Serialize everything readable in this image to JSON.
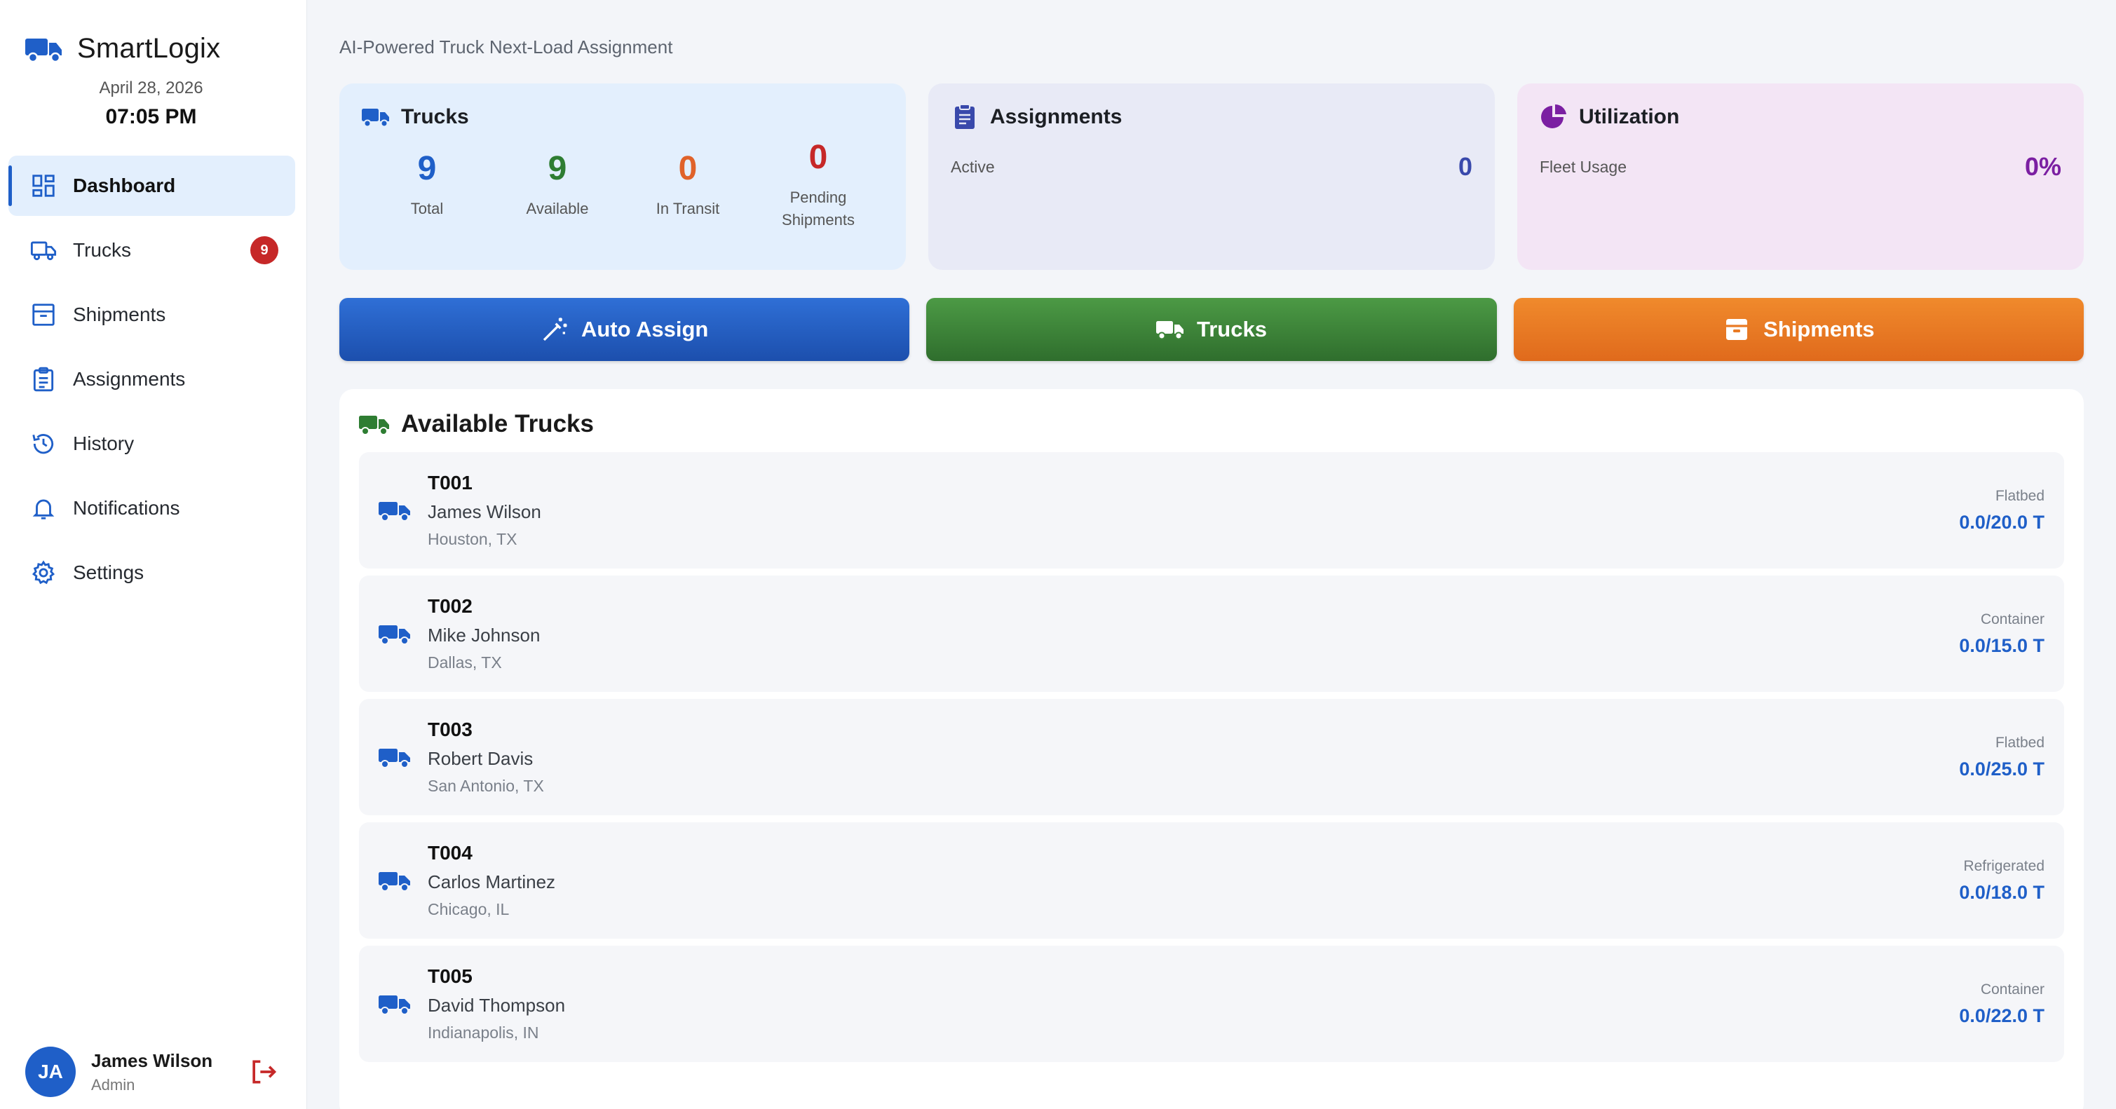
{
  "app": {
    "name": "SmartLogix",
    "date": "April 28, 2026",
    "time": "07:05 PM"
  },
  "sidebar": {
    "items": [
      {
        "label": "Dashboard",
        "icon": "dashboard-icon",
        "active": true
      },
      {
        "label": "Trucks",
        "icon": "truck-icon",
        "badge": "9"
      },
      {
        "label": "Shipments",
        "icon": "archive-icon"
      },
      {
        "label": "Assignments",
        "icon": "clipboard-icon"
      },
      {
        "label": "History",
        "icon": "history-icon"
      },
      {
        "label": "Notifications",
        "icon": "bell-icon"
      },
      {
        "label": "Settings",
        "icon": "gear-icon"
      }
    ]
  },
  "user": {
    "initials": "JA",
    "name": "James Wilson",
    "role": "Admin"
  },
  "header": {
    "subtitle": "AI-Powered Truck Next-Load Assignment"
  },
  "stats": {
    "trucks": {
      "title": "Trucks",
      "items": [
        {
          "value": "9",
          "label": "Total",
          "color": "#1f5fc8"
        },
        {
          "value": "9",
          "label": "Available",
          "color": "#2e7d32"
        },
        {
          "value": "0",
          "label": "In Transit",
          "color": "#e0622a"
        },
        {
          "value": "0",
          "label": "Pending Shipments",
          "color": "#c62828"
        }
      ]
    },
    "assignments": {
      "title": "Assignments",
      "key": "Active",
      "value": "0",
      "color": "#3949ab"
    },
    "utilization": {
      "title": "Utilization",
      "key": "Fleet Usage",
      "value": "0%",
      "color": "#7b1fa2"
    }
  },
  "actions": {
    "auto_assign": "Auto Assign",
    "trucks": "Trucks",
    "shipments": "Shipments"
  },
  "available": {
    "title": "Available Trucks",
    "trucks": [
      {
        "id": "T001",
        "driver": "James Wilson",
        "location": "Houston, TX",
        "type": "Flatbed",
        "capacity": "0.0/20.0 T"
      },
      {
        "id": "T002",
        "driver": "Mike Johnson",
        "location": "Dallas, TX",
        "type": "Container",
        "capacity": "0.0/15.0 T"
      },
      {
        "id": "T003",
        "driver": "Robert Davis",
        "location": "San Antonio, TX",
        "type": "Flatbed",
        "capacity": "0.0/25.0 T"
      },
      {
        "id": "T004",
        "driver": "Carlos Martinez",
        "location": "Chicago, IL",
        "type": "Refrigerated",
        "capacity": "0.0/18.0 T"
      },
      {
        "id": "T005",
        "driver": "David Thompson",
        "location": "Indianapolis, IN",
        "type": "Container",
        "capacity": "0.0/22.0 T"
      }
    ]
  }
}
